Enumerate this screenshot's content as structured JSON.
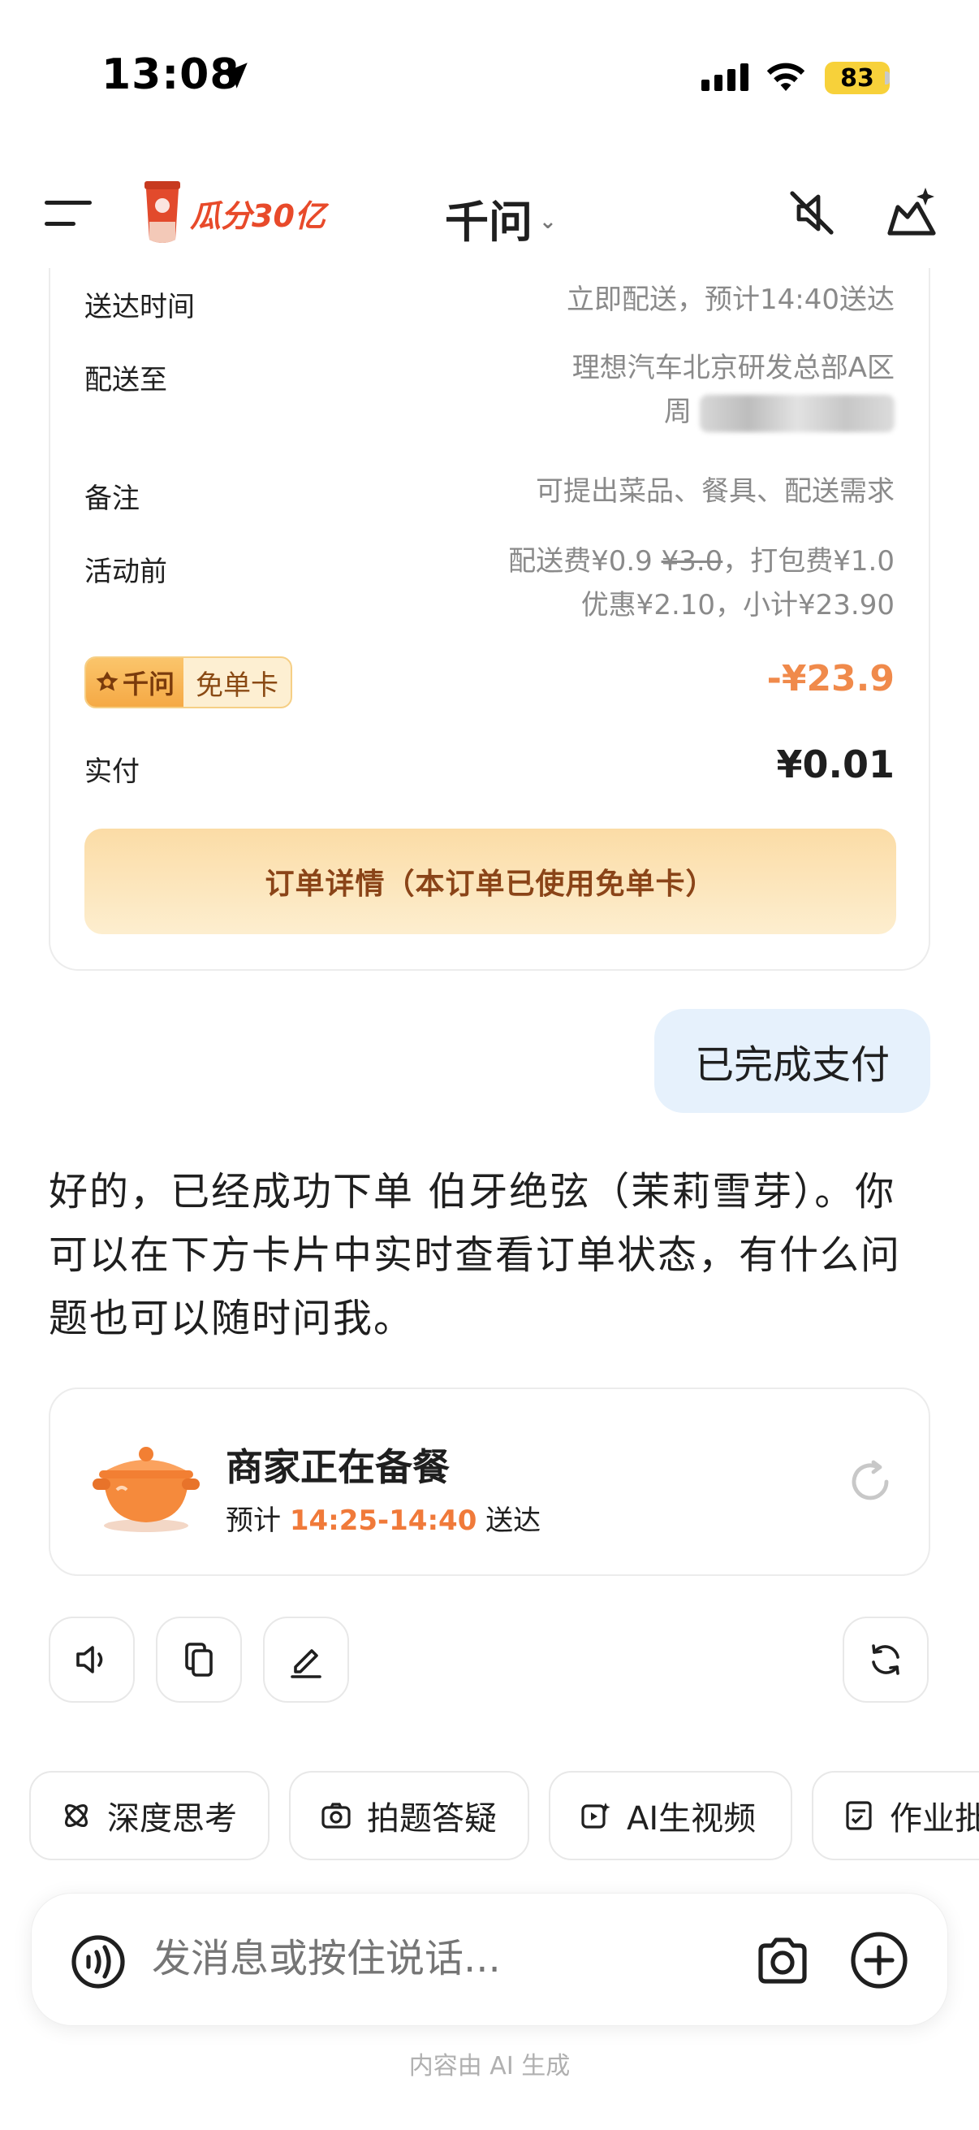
{
  "status_bar": {
    "time": "13:08",
    "battery": "83"
  },
  "header": {
    "promo_text": "瓜分30亿",
    "cup_label": "千问",
    "title": "千问",
    "title_chevron": "⌄"
  },
  "order": {
    "delivery_time_label": "送达时间",
    "delivery_time_value": "立即配送，预计14:40送达",
    "deliver_to_label": "配送至",
    "deliver_to_line1": "理想汽车北京研发总部A区",
    "deliver_to_line2": "周",
    "note_label": "备注",
    "note_value": "可提出菜品、餐具、配送需求",
    "promo_label": "活动前",
    "fee_prefix": "配送费¥0.9",
    "fee_original": "¥3.0",
    "fee_suffix": "，打包费¥1.0",
    "discount_line": "优惠¥2.10，小计¥23.90",
    "badge_brand": "千问",
    "badge_text": "免单卡",
    "discount_amount": "-¥23.9",
    "paid_label": "实付",
    "paid_value": "¥0.01",
    "detail_button": "订单详情（本订单已使用免单卡）"
  },
  "user_message": "已完成支付",
  "ai_message": "好的，已经成功下单 伯牙绝弦（茉莉雪芽）。你可以在下方卡片中实时查看订单状态，有什么问题也可以随时问我。",
  "status_card": {
    "title": "商家正在备餐",
    "eta_prefix": "预计 ",
    "eta_time": "14:25-14:40",
    "eta_suffix": " 送达"
  },
  "chips": [
    {
      "label": "深度思考",
      "icon": "deep-think-icon"
    },
    {
      "label": "拍题答疑",
      "icon": "camera-question-icon"
    },
    {
      "label": "AI生视频",
      "icon": "video-icon"
    },
    {
      "label": "作业批",
      "icon": "homework-icon"
    }
  ],
  "input": {
    "placeholder": "发消息或按住说话..."
  },
  "footer_note": "内容由 AI 生成",
  "colors": {
    "accent_orange": "#f07a3a",
    "user_bubble": "#e6f1fc",
    "badge_gold": "#f5a945"
  }
}
